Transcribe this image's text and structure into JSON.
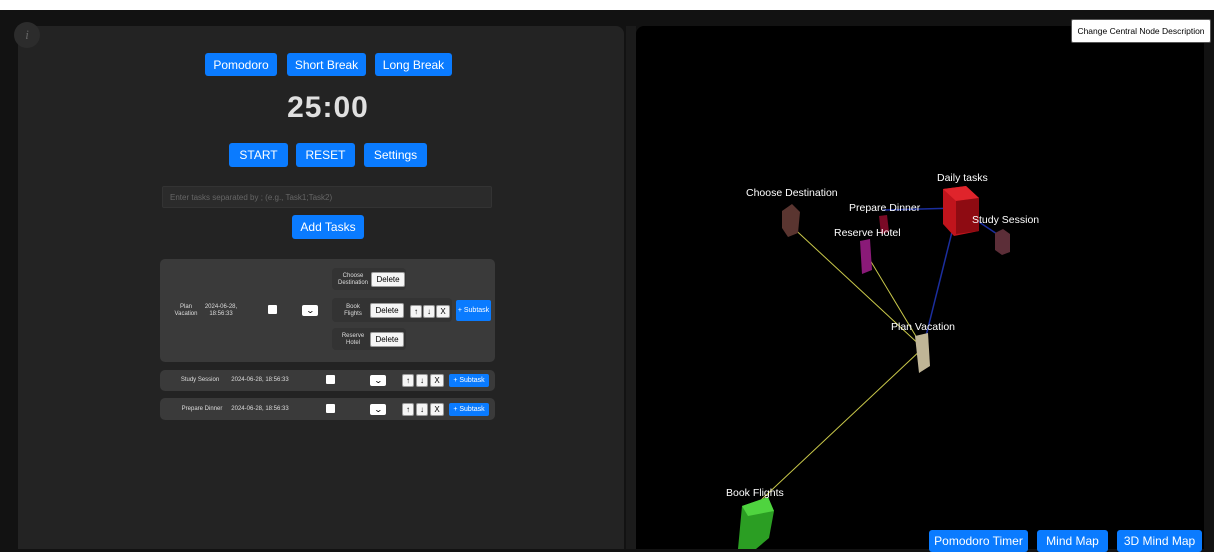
{
  "timer": {
    "modes": [
      "Pomodoro",
      "Short Break",
      "Long Break"
    ],
    "time": "25:00",
    "controls": [
      "START",
      "RESET",
      "Settings"
    ]
  },
  "tasks": {
    "placeholder": "Enter tasks separated by ; (e.g., Task1;Task2)",
    "add_label": "Add Tasks",
    "main": {
      "name": "Plan Vacation",
      "date": "2024-06-28, 18:56:33",
      "subtasks": [
        "Choose Destination",
        "Book Flights",
        "Reserve Hotel"
      ]
    },
    "rows": [
      {
        "name": "Study Session",
        "date": "2024-06-28, 18:56:33"
      },
      {
        "name": "Prepare Dinner",
        "date": "2024-06-28, 18:56:33"
      }
    ],
    "delete_label": "Delete",
    "up_label": "↑",
    "down_label": "↓",
    "remove_label": "X",
    "subtask_label": "+ Subtask"
  },
  "mindmap": {
    "change_label": "Change Central Node Description",
    "nodes": {
      "daily": "Daily tasks",
      "choose": "Choose Destination",
      "dinner": "Prepare Dinner",
      "study": "Study Session",
      "hotel": "Reserve Hotel",
      "plan": "Plan Vacation",
      "flights": "Book Flights"
    },
    "colors": {
      "daily": "#c0141c",
      "choose": "#5a3530",
      "dinner": "#7a0a26",
      "study": "#5c2e38",
      "hotel": "#8a1a78",
      "plan": "#bfb596",
      "flights": "#2b9e23",
      "link_blue": "#1b2e9e",
      "link_yellow": "#c9c84a"
    }
  },
  "nav": [
    "Pomodoro Timer",
    "Mind Map",
    "3D Mind Map"
  ]
}
